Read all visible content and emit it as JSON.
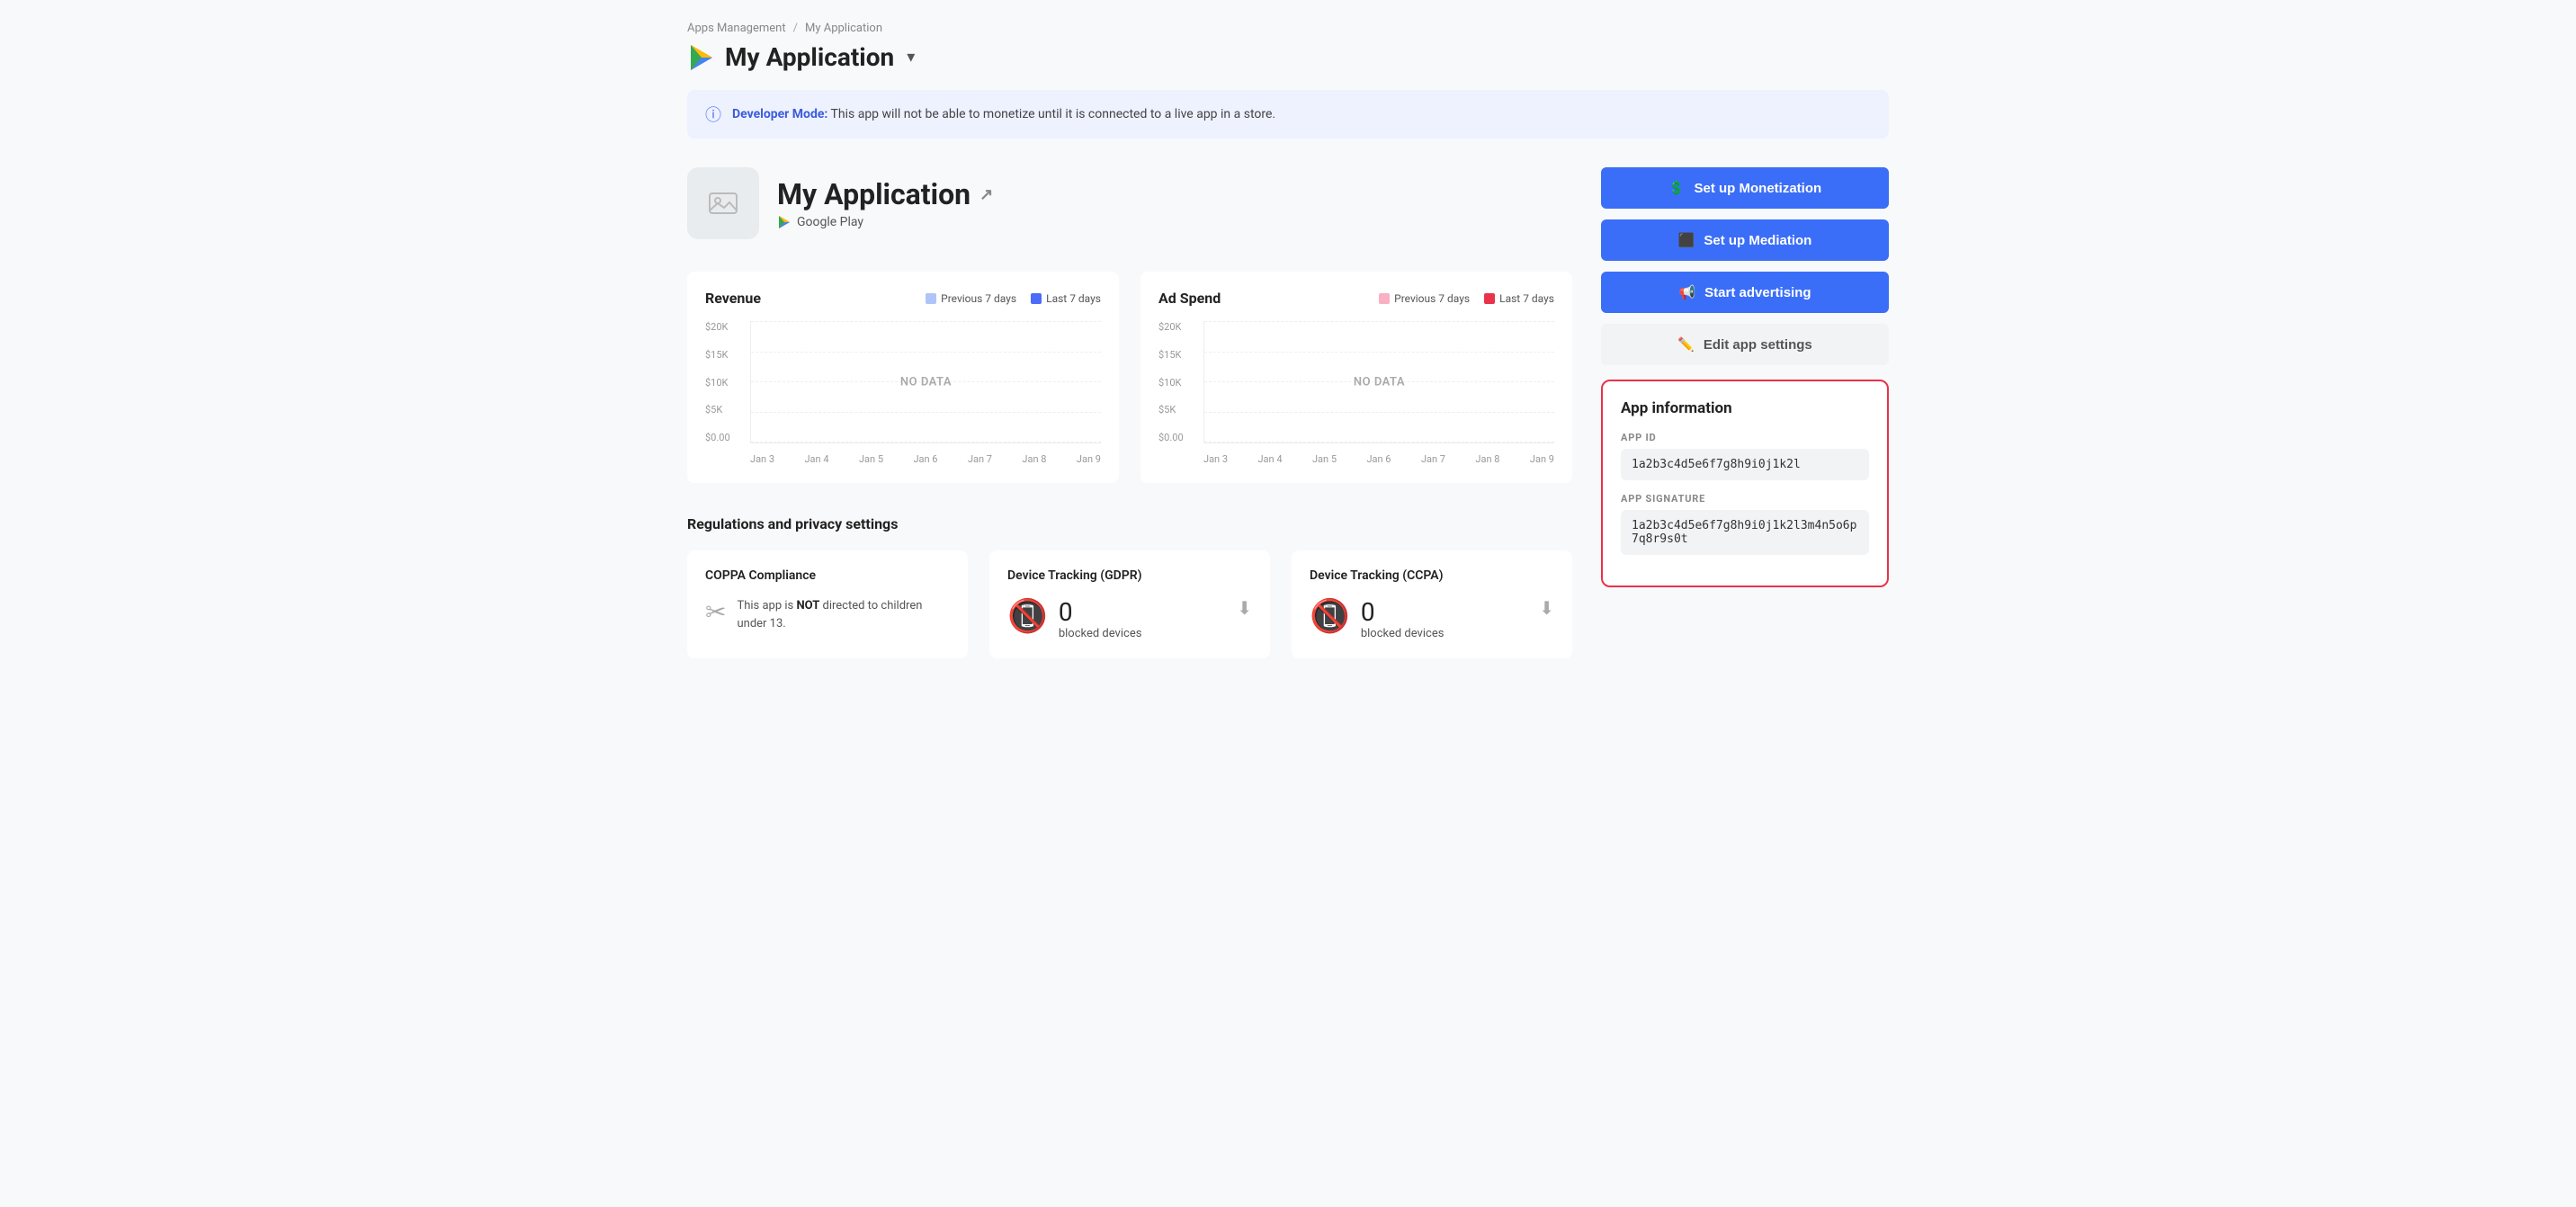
{
  "breadcrumb": {
    "parent": "Apps Management",
    "separator": "/",
    "current": "My Application"
  },
  "header": {
    "app_name": "My Application",
    "dropdown_symbol": "▾"
  },
  "dev_banner": {
    "label": "Developer Mode:",
    "message": " This app will not be able to monetize until it is connected to a live app in a store."
  },
  "app_detail": {
    "name": "My Application",
    "platform": "Google Play"
  },
  "buttons": {
    "monetization": "Set up Monetization",
    "mediation": "Set up Mediation",
    "advertising": "Start advertising",
    "edit_settings": "Edit app settings"
  },
  "app_information": {
    "title": "App information",
    "app_id_label": "APP ID",
    "app_id_value": "1a2b3c4d5e6f7g8h9i0j1k2l",
    "app_sig_label": "APP SIGNATURE",
    "app_sig_value": "1a2b3c4d5e6f7g8h9i0j1k2l3m4n5o6p7q8r9s0t"
  },
  "revenue_chart": {
    "title": "Revenue",
    "legend_prev": "Previous 7 days",
    "legend_last": "Last 7 days",
    "y_labels": [
      "$20K",
      "$15K",
      "$10K",
      "$5K",
      "$0.00"
    ],
    "x_labels": [
      "Jan 3",
      "Jan 4",
      "Jan 5",
      "Jan 6",
      "Jan 7",
      "Jan 8",
      "Jan 9"
    ],
    "no_data": "NO DATA"
  },
  "adspend_chart": {
    "title": "Ad Spend",
    "legend_prev": "Previous 7 days",
    "legend_last": "Last 7 days",
    "y_labels": [
      "$20K",
      "$15K",
      "$10K",
      "$5K",
      "$0.00"
    ],
    "x_labels": [
      "Jan 3",
      "Jan 4",
      "Jan 5",
      "Jan 6",
      "Jan 7",
      "Jan 8",
      "Jan 9"
    ],
    "no_data": "NO DATA"
  },
  "regulations": {
    "section_title": "Regulations and privacy settings",
    "coppa": {
      "title": "COPPA Compliance",
      "text_pre": "This app is ",
      "text_bold": "NOT",
      "text_post": " directed to children under 13."
    },
    "gdpr": {
      "title": "Device Tracking (GDPR)",
      "count": "0",
      "label": "blocked devices"
    },
    "ccpa": {
      "title": "Device Tracking (CCPA)",
      "count": "0",
      "label": "blocked devices"
    }
  }
}
